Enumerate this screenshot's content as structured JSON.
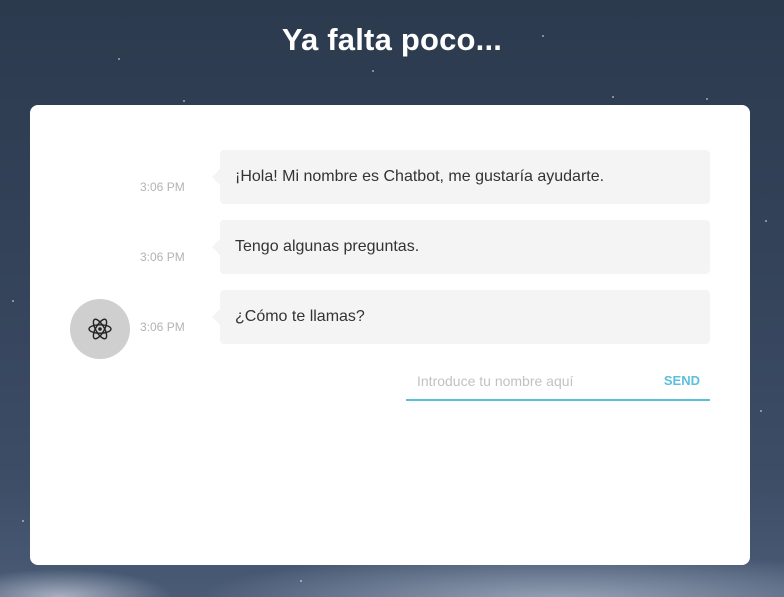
{
  "header": {
    "title": "Ya falta poco..."
  },
  "chat": {
    "messages": [
      {
        "time": "3:06 PM",
        "text": "¡Hola! Mi nombre es Chatbot, me gustaría ayudarte."
      },
      {
        "time": "3:06 PM",
        "text": "Tengo algunas preguntas."
      },
      {
        "time": "3:06 PM",
        "text": "¿Cómo te llamas?"
      }
    ],
    "avatar_icon": "atom-icon",
    "input": {
      "value": "",
      "placeholder": "Introduce tu nombre aquí"
    },
    "send_label": "SEND"
  },
  "colors": {
    "accent": "#5bc0de",
    "bubble": "#f4f4f4",
    "avatar": "#cfcfcf"
  }
}
